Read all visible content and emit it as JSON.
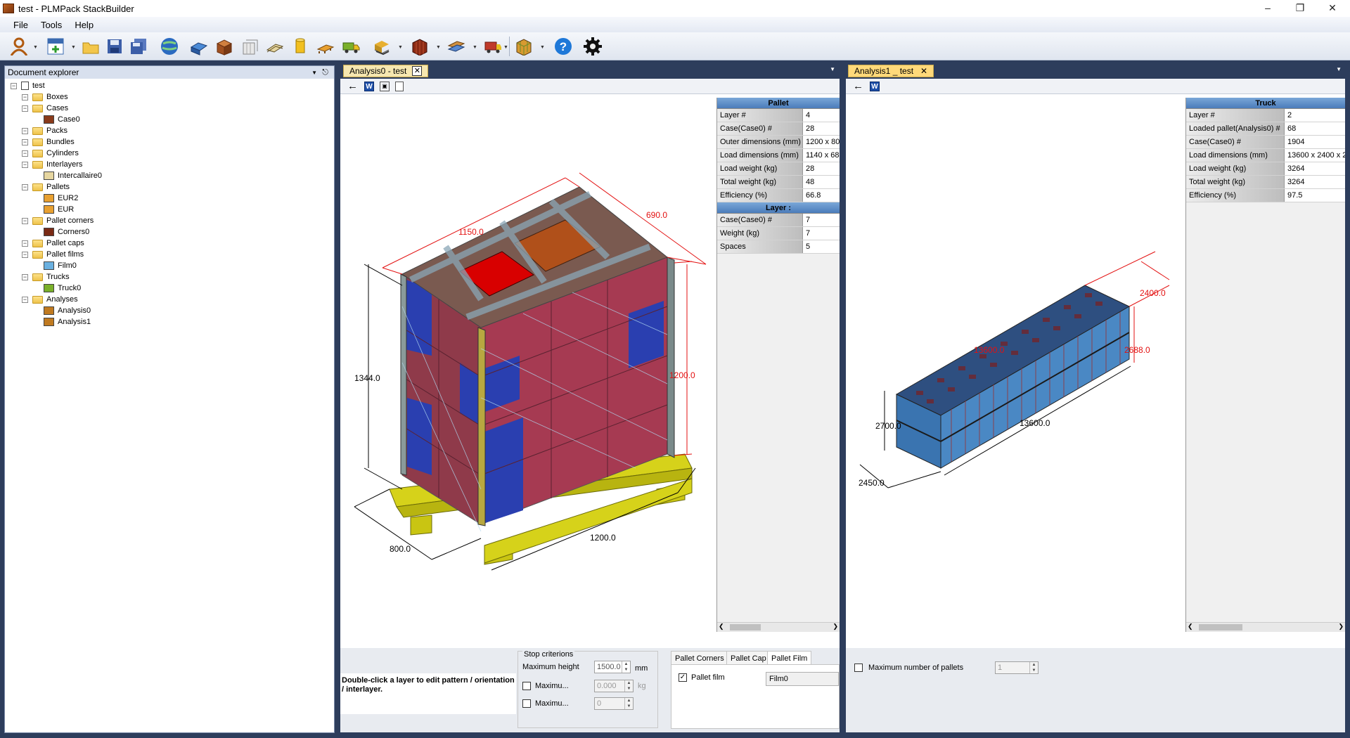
{
  "window": {
    "title": "test - PLMPack StackBuilder"
  },
  "menu": [
    "File",
    "Tools",
    "Help"
  ],
  "toolbar_icons": [
    "user-icon",
    "new-document-icon",
    "open-folder-icon",
    "save-icon",
    "save-all-icon",
    "database-icon",
    "new-box-icon",
    "new-case-icon",
    "new-bundle-icon",
    "new-interlayer-icon",
    "new-cylinder-icon",
    "new-pallet-icon",
    "new-truck-icon",
    "analysis-casepallet-icon",
    "analysis-box-case-icon",
    "analysis-pallet-truck-icon",
    "analysis-case-truck-icon",
    "optimization-icon",
    "help-icon",
    "settings-icon"
  ],
  "explorer": {
    "title": "Document explorer",
    "tree": [
      {
        "label": "test",
        "level": 0,
        "kind": "doc"
      },
      {
        "label": "Boxes",
        "level": 1,
        "kind": "folder"
      },
      {
        "label": "Cases",
        "level": 1,
        "kind": "folder"
      },
      {
        "label": "Case0",
        "level": 2,
        "kind": "case"
      },
      {
        "label": "Packs",
        "level": 1,
        "kind": "folder"
      },
      {
        "label": "Bundles",
        "level": 1,
        "kind": "folder"
      },
      {
        "label": "Cylinders",
        "level": 1,
        "kind": "folder"
      },
      {
        "label": "Interlayers",
        "level": 1,
        "kind": "folder"
      },
      {
        "label": "Intercallaire0",
        "level": 2,
        "kind": "interlayer"
      },
      {
        "label": "Pallets",
        "level": 1,
        "kind": "folder"
      },
      {
        "label": "EUR2",
        "level": 2,
        "kind": "pallet"
      },
      {
        "label": "EUR",
        "level": 2,
        "kind": "pallet"
      },
      {
        "label": "Pallet corners",
        "level": 1,
        "kind": "folder"
      },
      {
        "label": "Corners0",
        "level": 2,
        "kind": "corner"
      },
      {
        "label": "Pallet caps",
        "level": 1,
        "kind": "folder"
      },
      {
        "label": "Pallet films",
        "level": 1,
        "kind": "folder"
      },
      {
        "label": "Film0",
        "level": 2,
        "kind": "film"
      },
      {
        "label": "Trucks",
        "level": 1,
        "kind": "folder"
      },
      {
        "label": "Truck0",
        "level": 2,
        "kind": "truck"
      },
      {
        "label": "Analyses",
        "level": 1,
        "kind": "folder"
      },
      {
        "label": "Analysis0",
        "level": 2,
        "kind": "analysis"
      },
      {
        "label": "Analysis1",
        "level": 2,
        "kind": "analysis"
      }
    ]
  },
  "analysis0": {
    "tab": "Analysis0 - test",
    "dims": {
      "top_length": "1150.0",
      "top_width": "690.0",
      "height_left": "1344.0",
      "height_right": "1200.0",
      "bottom_width": "800.0",
      "bottom_length": "1200.0"
    },
    "pallet_header": "Pallet",
    "pallet_rows": [
      {
        "k": "Layer #",
        "v": "4"
      },
      {
        "k": "Case(Case0) #",
        "v": "28"
      },
      {
        "k": "Outer dimensions (mm)",
        "v": "1200 x 80"
      },
      {
        "k": "Load dimensions (mm)",
        "v": "1140 x 68"
      },
      {
        "k": "Load weight (kg)",
        "v": "28"
      },
      {
        "k": "Total weight (kg)",
        "v": "48"
      },
      {
        "k": "Efficiency (%)",
        "v": "66.8"
      }
    ],
    "layer_header": "Layer :",
    "layer_rows": [
      {
        "k": "Case(Case0) #",
        "v": "7"
      },
      {
        "k": "Weight (kg)",
        "v": "7"
      },
      {
        "k": "Spaces",
        "v": "5"
      }
    ],
    "hint": "Double-click a layer to edit pattern / orientation / interlayer.",
    "stop": {
      "title": "Stop criterions",
      "max_height_label": "Maximum height",
      "max_height_value": "1500.0",
      "max_height_unit": "mm",
      "max_weight_label": "Maximu...",
      "max_weight_value": "0.000",
      "max_weight_unit": "kg",
      "max_count_label": "Maximu...",
      "max_count_value": "0"
    },
    "subtabs": [
      "Pallet Corners",
      "Pallet Cap",
      "Pallet Film"
    ],
    "film": {
      "label": "Pallet film",
      "value": "Film0"
    }
  },
  "analysis1": {
    "tab": "Analysis1 _ test",
    "dims": {
      "top_width": "2400.0",
      "top_length": "13600.0",
      "height_right": "2688.0",
      "height_left": "2700.0",
      "bottom_length": "13600.0",
      "bottom_width": "2450.0"
    },
    "truck_header": "Truck",
    "truck_rows": [
      {
        "k": "Layer #",
        "v": "2"
      },
      {
        "k": "Loaded pallet(Analysis0) #",
        "v": "68"
      },
      {
        "k": "Case(Case0) #",
        "v": "1904"
      },
      {
        "k": "Load dimensions (mm)",
        "v": "13600 x 2400 x 2"
      },
      {
        "k": "Load weight (kg)",
        "v": "3264"
      },
      {
        "k": "Total weight (kg)",
        "v": "3264"
      },
      {
        "k": "Efficiency (%)",
        "v": "97.5"
      }
    ],
    "max_pallets_label": "Maximum number of pallets",
    "max_pallets_value": "1"
  },
  "colors": {
    "frame": "#2d3d5c",
    "case": "#9b3a4a",
    "case_blue": "#2a3fb0",
    "pallet": "#d6d21a",
    "grid_header": "#5a88c4"
  }
}
